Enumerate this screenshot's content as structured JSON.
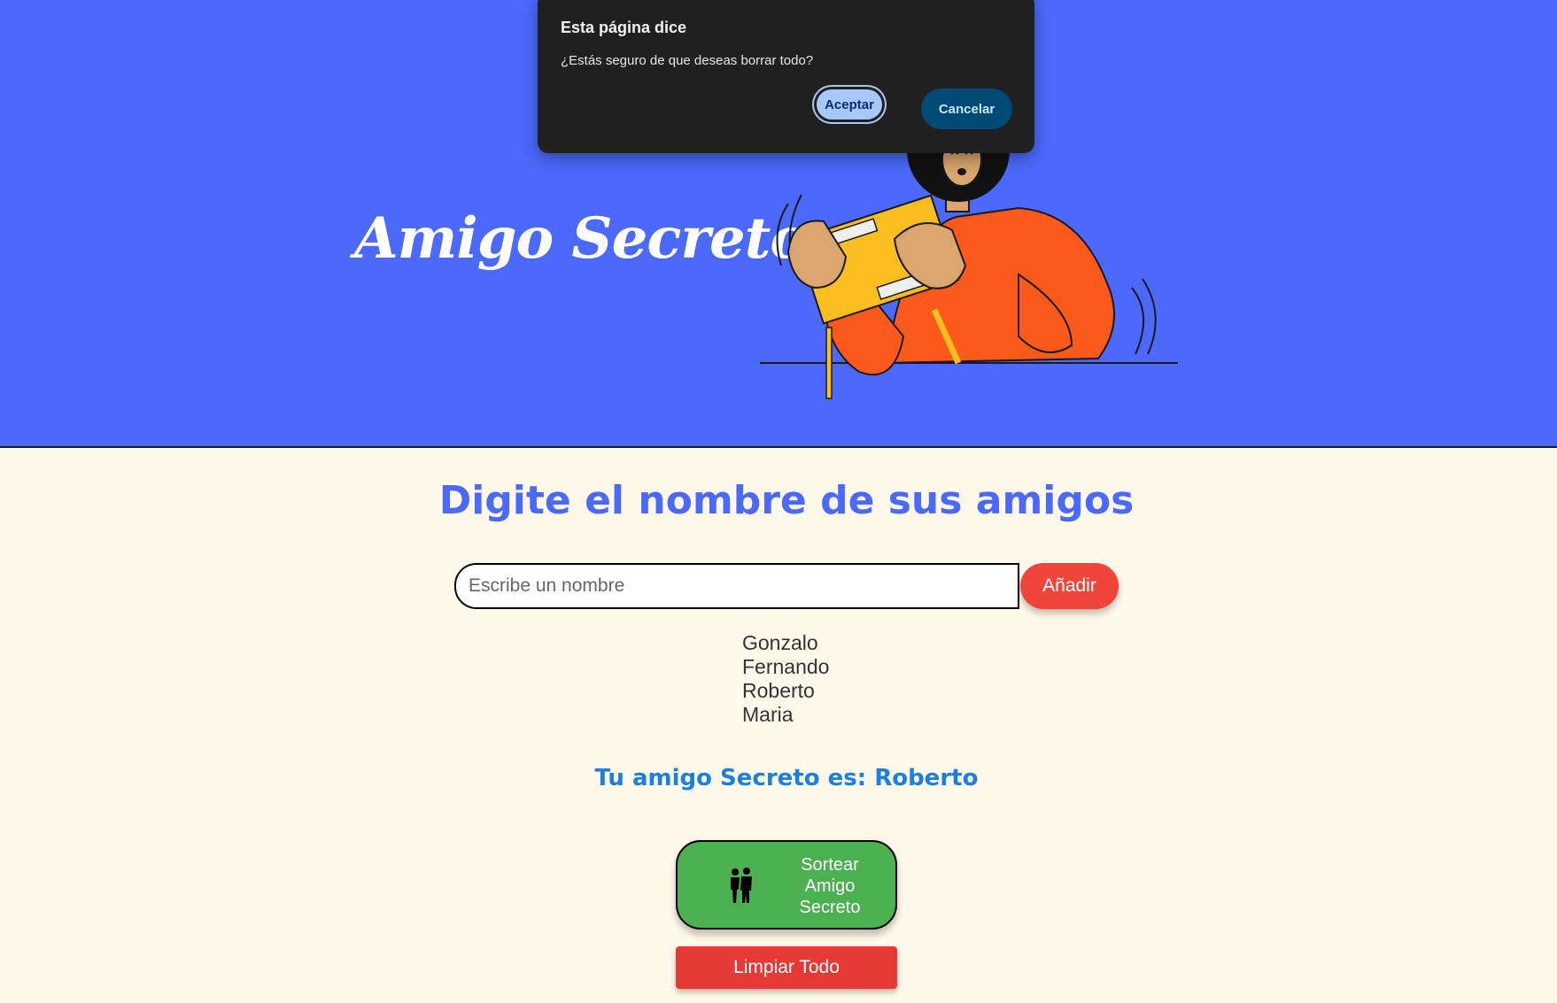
{
  "header": {
    "title": "Amigo Secreto"
  },
  "main": {
    "heading": "Digite el nombre de sus amigos",
    "input": {
      "placeholder": "Escribe un nombre",
      "value": ""
    },
    "add_label": "Añadir",
    "friends": [
      "Gonzalo",
      "Fernando",
      "Roberto",
      "Maria"
    ],
    "result": "Tu amigo Secreto es: Roberto",
    "draw_label": "Sortear Amigo Secreto",
    "draw_icon": "people-icon",
    "clear_label": "Limpiar Todo"
  },
  "dialog": {
    "title": "Esta página dice",
    "message": "¿Estás seguro de que deseas borrar todo?",
    "accept_label": "Aceptar",
    "cancel_label": "Cancelar"
  },
  "colors": {
    "header_bg": "#4b69fd",
    "page_bg": "#fff9eb",
    "heading": "#4b69fd",
    "add_button": "#f0453a",
    "result_text": "#1a7fe0",
    "draw_button": "#4caf50",
    "clear_button": "#e53935",
    "dialog_bg": "#202020"
  }
}
